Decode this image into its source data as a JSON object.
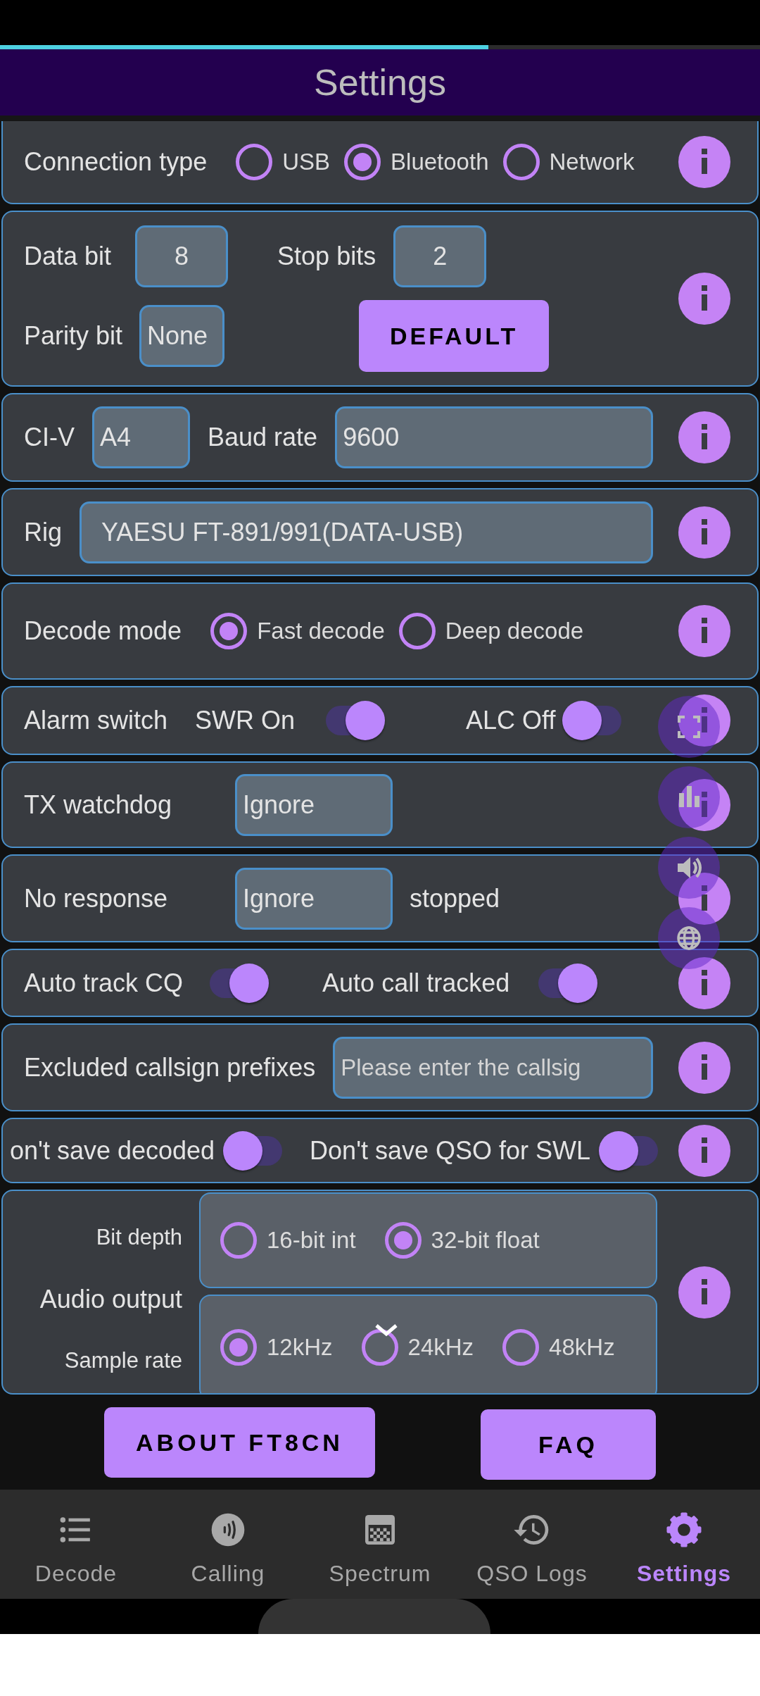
{
  "progress": {
    "level": 0.643
  },
  "title": "Settings",
  "settings": [
    {
      "kind": "radio",
      "label": "Connection type",
      "options": [
        {
          "label": "USB",
          "selected": false
        },
        {
          "label": "Bluetooth",
          "selected": true
        },
        {
          "label": "Network",
          "selected": false
        }
      ]
    },
    {
      "kind": "serial",
      "fields": [
        {
          "label": "Data bit",
          "value": "8"
        },
        {
          "label": "Stop bits",
          "value": "2"
        },
        {
          "label": "Parity bit",
          "value": "None"
        }
      ],
      "button": "DEFAULT"
    },
    {
      "kind": "fields",
      "fields": [
        {
          "label": "CI-V",
          "value": "A4"
        },
        {
          "label": "Baud rate",
          "value": "9600"
        }
      ]
    },
    {
      "kind": "fields",
      "fields": [
        {
          "label": "Rig",
          "value": "YAESU FT-891/991(DATA-USB)"
        }
      ]
    },
    {
      "kind": "radio",
      "label": "Decode mode",
      "options": [
        {
          "label": "Fast decode",
          "selected": true
        },
        {
          "label": "Deep decode",
          "selected": false
        }
      ]
    },
    {
      "kind": "switches",
      "label": "Alarm switch",
      "switches": [
        {
          "label": "SWR On",
          "on": true
        },
        {
          "label": "ALC Off",
          "on": false
        }
      ]
    },
    {
      "kind": "fields",
      "fields": [
        {
          "label": "TX watchdog",
          "value": "Ignore"
        }
      ]
    },
    {
      "kind": "fields",
      "fields": [
        {
          "label": "No response",
          "value": "Ignore"
        }
      ],
      "suffix": "stopped"
    },
    {
      "kind": "switches",
      "switches": [
        {
          "label": "Auto track CQ",
          "on": true
        },
        {
          "label": "Auto call tracked",
          "on": true
        }
      ]
    },
    {
      "kind": "fields",
      "fields": [
        {
          "label": "Excluded callsign prefixes",
          "placeholder": "Please enter the callsig"
        }
      ]
    },
    {
      "kind": "switches",
      "switches": [
        {
          "label": "on't save decoded",
          "on": false
        },
        {
          "label": "Don't save QSO for SWL",
          "on": false
        }
      ]
    },
    {
      "kind": "audio",
      "label": "Audio output",
      "groups": [
        {
          "label": "Bit depth",
          "options": [
            {
              "label": "16-bit int",
              "selected": false
            },
            {
              "label": "32-bit float",
              "selected": true
            }
          ]
        },
        {
          "label": "Sample rate",
          "options": [
            {
              "label": "12kHz",
              "selected": true
            },
            {
              "label": "24kHz",
              "selected": false
            },
            {
              "label": "48kHz",
              "selected": false
            }
          ]
        }
      ]
    }
  ],
  "buttons": [
    "ABOUT FT8CN",
    "FAQ"
  ],
  "nav": [
    {
      "label": "Decode",
      "selected": false
    },
    {
      "label": "Calling",
      "selected": false
    },
    {
      "label": "Spectrum",
      "selected": false
    },
    {
      "label": "QSO Logs",
      "selected": false
    },
    {
      "label": "Settings",
      "selected": true
    }
  ]
}
